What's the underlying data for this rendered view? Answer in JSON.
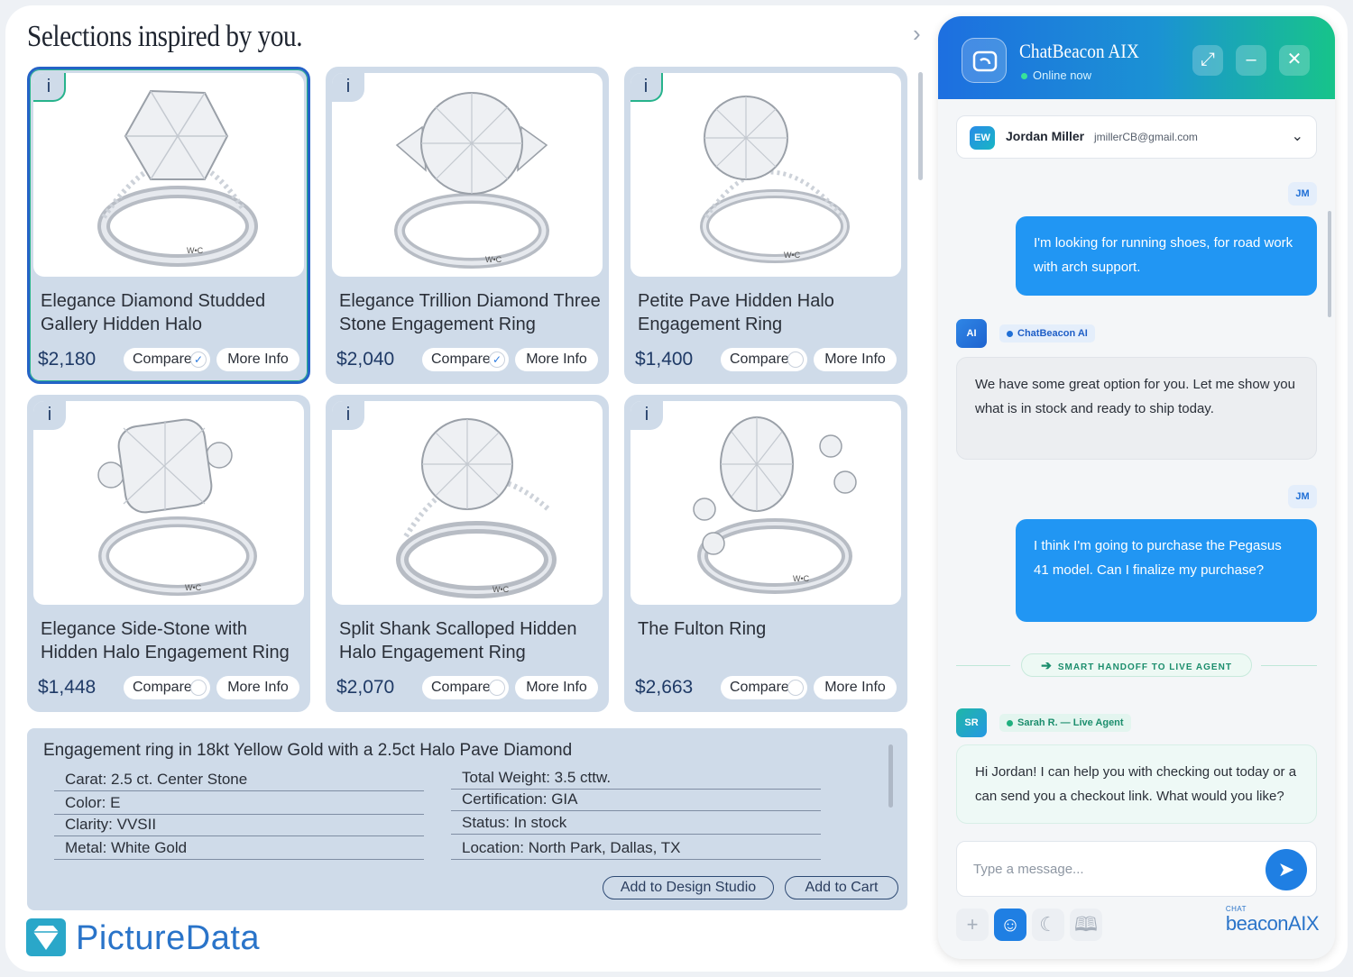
{
  "page": {
    "title": "Selections inspired by you."
  },
  "products": [
    {
      "name": "Elegance Diamond Studded Gallery Hidden Halo",
      "price": "$2,180",
      "compare_label": "Compare",
      "more_label": "More Info",
      "info": "i",
      "compared": true,
      "selected": true
    },
    {
      "name": "Elegance Trillion Diamond Three Stone Engagement Ring",
      "price": "$2,040",
      "compare_label": "Compare",
      "more_label": "More Info",
      "info": "i",
      "compared": true,
      "selected": false
    },
    {
      "name": "Petite Pave Hidden Halo Engagement Ring",
      "price": "$1,400",
      "compare_label": "Compare",
      "more_label": "More Info",
      "info": "i",
      "compared": false,
      "selected": false
    },
    {
      "name": "Elegance Side-Stone with Hidden Halo Engagement Ring",
      "price": "$1,448",
      "compare_label": "Compare",
      "more_label": "More Info",
      "info": "i",
      "compared": false,
      "selected": false
    },
    {
      "name": "Split Shank Scalloped Hidden Halo Engagement Ring",
      "price": "$2,070",
      "compare_label": "Compare",
      "more_label": "More Info",
      "info": "i",
      "compared": false,
      "selected": false
    },
    {
      "name": "The Fulton Ring",
      "price": "$2,663",
      "compare_label": "Compare",
      "more_label": "More Info",
      "info": "i",
      "compared": false,
      "selected": false
    }
  ],
  "details": {
    "title": "Engagement ring in 18kt Yellow Gold with a 2.5ct Halo Pave Diamond",
    "left": [
      "Carat:   2.5 ct. Center Stone",
      "Color:   E",
      "Clarity:   VVSII",
      "Metal:   White Gold"
    ],
    "right": [
      "Total Weight:   3.5 cttw.",
      "Certification:   GIA",
      "Status:   In stock",
      "Location:   North Park, Dallas, TX"
    ],
    "design_label": "Add to Design Studio",
    "cart_label": "Add to Cart"
  },
  "brand": {
    "name": "PictureData"
  },
  "chat": {
    "title": "ChatBeacon AIX",
    "status": "Online now",
    "user": {
      "initials": "EW",
      "name": "Jordan Miller",
      "email": "jmillerCB@gmail.com"
    },
    "messages": {
      "m1_tag": "JM",
      "m1": "I'm looking for running shoes, for road work with arch support.",
      "m2_tag": "AI",
      "m2_sender": "ChatBeacon AI",
      "m2": "We have some great option for you. Let me show you what is in stock and ready to ship today.",
      "m3_tag": "JM",
      "m3": "I think I'm going to purchase the Pegasus 41 model. Can I finalize my purchase?",
      "handoff": "SMART HANDOFF TO LIVE AGENT",
      "m4_tag": "SR",
      "m4_sender": "Sarah R. — Live Agent",
      "m4": "Hi Jordan! I can help you with checking out today or a can send you a checkout link. What would you like?"
    },
    "composer_placeholder": "Type a message...",
    "brand_small": "CHAT",
    "brand": "beaconAIX"
  },
  "icons": {
    "collapse": "chevron-right-icon",
    "minimize": "minimize-icon",
    "shrink": "shrink-icon",
    "close": "close-icon",
    "send": "send-icon",
    "plus": "plus-icon",
    "emoji": "emoji-icon",
    "moon": "moon-icon",
    "book": "book-icon"
  },
  "colors": {
    "accent": "#2196f3",
    "brand_blue": "#2a74c9",
    "card_bg": "#cfdbe9",
    "selected_border": "#2563c7",
    "live_green": "#1c8e6d"
  }
}
